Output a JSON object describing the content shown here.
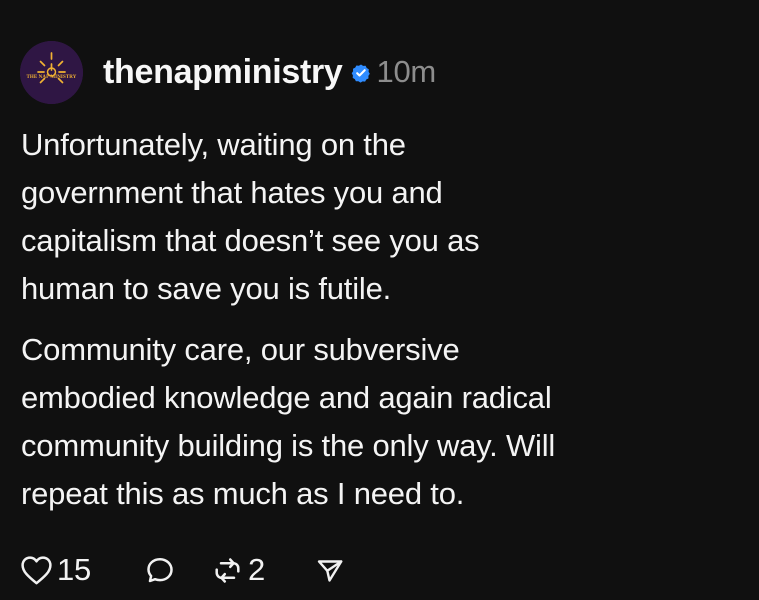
{
  "post": {
    "avatar": {
      "text": "THE NAP MINISTRY",
      "logo_icon": "sunburst-icon",
      "bg_color": "#2f1644",
      "accent_color": "#f1b233"
    },
    "header": {
      "username": "thenapministry",
      "verified_icon": "verified-badge-icon",
      "verified_color": "#2f8cff",
      "timestamp": "10m"
    },
    "body": {
      "paragraphs": [
        {
          "lines": [
            "Unfortunately, waiting on the",
            "government that hates you and",
            "capitalism that doesn’t see you as",
            "human to save you is futile."
          ]
        },
        {
          "lines": [
            "Community care, our subversive",
            "embodied knowledge and again radical",
            "community building is the only way.  Will",
            "repeat this as much as I need to."
          ]
        }
      ]
    },
    "actions": {
      "like": {
        "icon": "heart-icon",
        "count": "15"
      },
      "reply": {
        "icon": "speech-bubble-icon"
      },
      "repost": {
        "icon": "repost-icon",
        "count": "2"
      },
      "share": {
        "icon": "send-icon"
      }
    }
  }
}
